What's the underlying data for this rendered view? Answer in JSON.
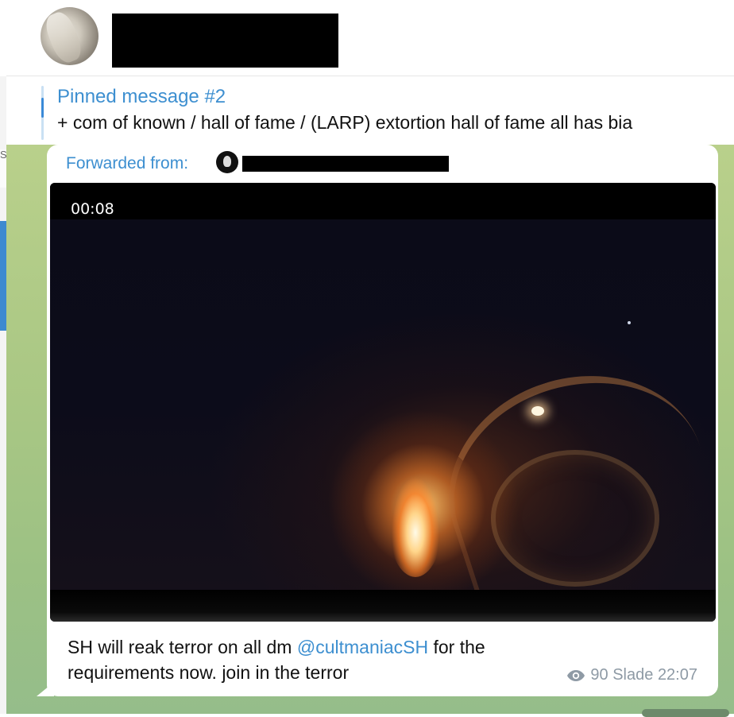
{
  "header": {
    "avatar": "profile-photo"
  },
  "pinned": {
    "title": "Pinned message #2",
    "text": "+ com of known / hall of fame / (LARP) extortion hall of fame all has bia"
  },
  "sidebar": {
    "edge_letter": "S"
  },
  "message": {
    "forwarded_label": "Forwarded from:",
    "video": {
      "duration": "00:08"
    },
    "caption_part1": "SH will reak terror on all dm ",
    "mention": "@cultmaniacSH",
    "caption_part2": " for the requirements now. join in the terror",
    "views": "90",
    "author": "Slade",
    "time": "22:07"
  },
  "colors": {
    "accent": "#3d8fd0",
    "chat_background": "#a9c784",
    "meta_text": "#8e9aa5"
  }
}
